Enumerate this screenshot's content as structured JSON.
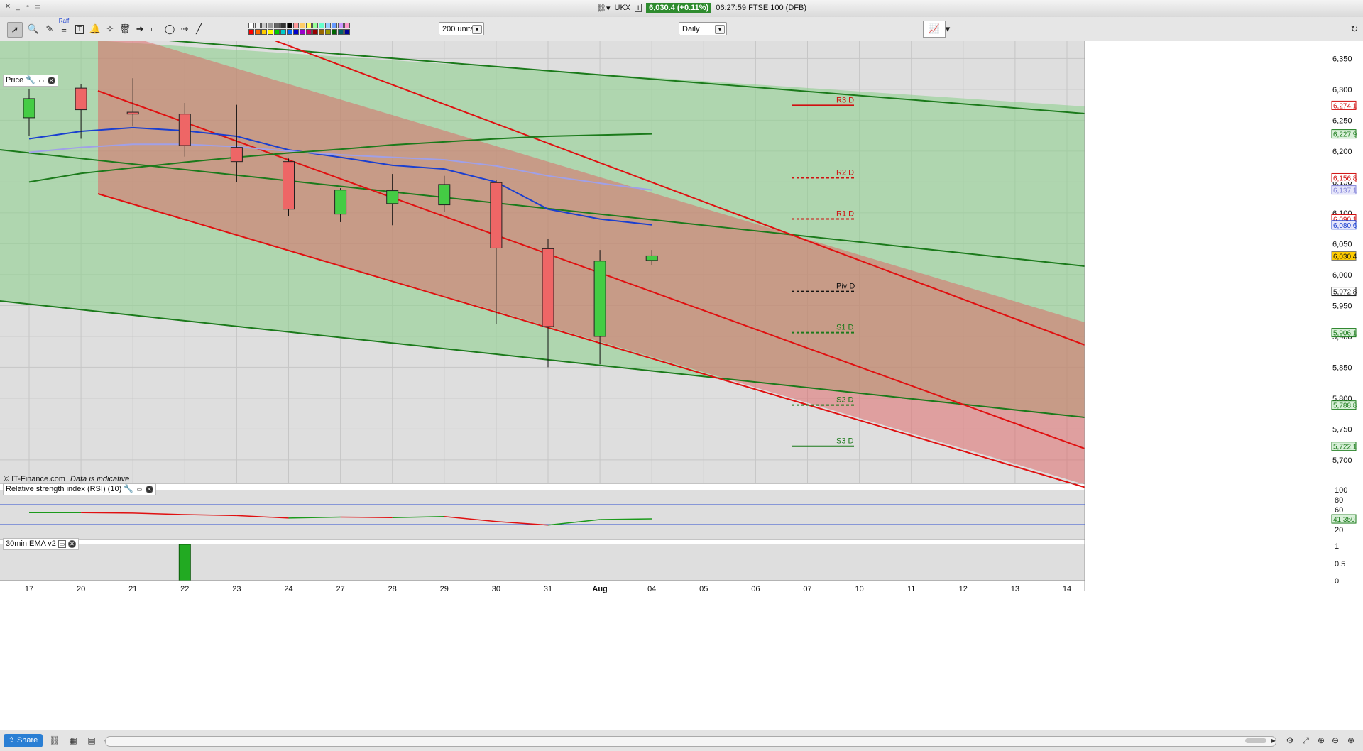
{
  "window": {
    "symbol": "UKX",
    "price_badge": "6,030.4 (+0.11%)",
    "time_title": "06:27:59 FTSE 100 (DFB)"
  },
  "toolbar": {
    "units_select": "200 units",
    "interval_select": "Daily",
    "raff_label": "Raff",
    "colors": [
      "#ffffff",
      "#eeeeee",
      "#cccccc",
      "#999999",
      "#666666",
      "#333333",
      "#000000",
      "#ff9999",
      "#ffcc66",
      "#ffff66",
      "#99ff99",
      "#66ffcc",
      "#99ccff",
      "#6699ff",
      "#cc99ff",
      "#ff99cc",
      "#ff0000",
      "#ff6600",
      "#ffcc00",
      "#ffff00",
      "#00cc00",
      "#00cccc",
      "#0066ff",
      "#0000cc",
      "#9900cc",
      "#cc0066",
      "#990000",
      "#996600",
      "#999900",
      "#006600",
      "#006666",
      "#000099"
    ]
  },
  "price_panel": {
    "title": "Price",
    "copyright": "© IT-Finance.com",
    "indicative": "Data is indicative",
    "y_ticks": [
      "6,350",
      "6,300",
      "6,250",
      "6,200",
      "6,150",
      "6,100",
      "6,050",
      "6,000",
      "5,950",
      "5,900",
      "5,850",
      "5,800",
      "5,750",
      "5,700"
    ],
    "tags": [
      {
        "label": "6,274.1",
        "value": 6274.1,
        "bg": "#ffffff",
        "color": "#d01010",
        "border": "#d01010"
      },
      {
        "label": "6,227.9",
        "value": 6227.9,
        "bg": "#d9f0d9",
        "color": "#1b7a1b",
        "border": "#1b7a1b"
      },
      {
        "label": "6,156.8",
        "value": 6156.8,
        "bg": "#ffffff",
        "color": "#d01010",
        "border": "#d01010"
      },
      {
        "label": "6,137.1",
        "value": 6137.1,
        "bg": "#e6e6fa",
        "color": "#8080d8",
        "border": "#8080d8"
      },
      {
        "label": "6,090.1",
        "value": 6090.1,
        "bg": "#ffffff",
        "color": "#d01010",
        "border": "#d01010"
      },
      {
        "label": "6,080.6",
        "value": 6080.6,
        "bg": "#e6e6fa",
        "color": "#1a3fd0",
        "border": "#1a3fd0"
      },
      {
        "label": "6,030.4",
        "value": 6030.4,
        "bg": "#ffcc00",
        "color": "#111111",
        "border": "#777777"
      },
      {
        "label": "5,972.8",
        "value": 5972.8,
        "bg": "#ffffff",
        "color": "#111111",
        "border": "#111111"
      },
      {
        "label": "5,906.1",
        "value": 5906.1,
        "bg": "#d9f0d9",
        "color": "#1b7a1b",
        "border": "#1b7a1b"
      },
      {
        "label": "5,788.8",
        "value": 5788.8,
        "bg": "#d9f0d9",
        "color": "#1b7a1b",
        "border": "#1b7a1b"
      },
      {
        "label": "5,722.1",
        "value": 5722.1,
        "bg": "#d9f0d9",
        "color": "#1b7a1b",
        "border": "#1b7a1b"
      }
    ]
  },
  "pivots": [
    {
      "label": "R3 D",
      "value": 6274.1,
      "color": "#d01010",
      "dash": false
    },
    {
      "label": "R2 D",
      "value": 6156.8,
      "color": "#d01010",
      "dash": true
    },
    {
      "label": "R1 D",
      "value": 6090.1,
      "color": "#d01010",
      "dash": true
    },
    {
      "label": "Piv D",
      "value": 5972.8,
      "color": "#111111",
      "dash": true
    },
    {
      "label": "S1 D",
      "value": 5906.1,
      "color": "#1b7a1b",
      "dash": true
    },
    {
      "label": "S2 D",
      "value": 5788.8,
      "color": "#1b7a1b",
      "dash": true
    },
    {
      "label": "S3 D",
      "value": 5722.1,
      "color": "#1b7a1b",
      "dash": false
    }
  ],
  "chart_data": {
    "type": "candlestick",
    "x_labels": [
      "17",
      "20",
      "21",
      "22",
      "23",
      "24",
      "27",
      "28",
      "29",
      "30",
      "31",
      "Aug",
      "04",
      "05",
      "06",
      "07",
      "10",
      "11",
      "12",
      "13",
      "14"
    ],
    "ylim": [
      5662,
      6378
    ],
    "candles": [
      {
        "x": "17",
        "open": 6254,
        "close": 6285,
        "high": 6300,
        "low": 6225
      },
      {
        "x": "20",
        "open": 6302,
        "close": 6267,
        "high": 6308,
        "low": 6220
      },
      {
        "x": "21",
        "open": 6263,
        "close": 6260,
        "high": 6318,
        "low": 6240
      },
      {
        "x": "22",
        "open": 6260,
        "close": 6209,
        "high": 6278,
        "low": 6191
      },
      {
        "x": "23",
        "open": 6206,
        "close": 6183,
        "high": 6275,
        "low": 6150
      },
      {
        "x": "24",
        "open": 6183,
        "close": 6106,
        "high": 6188,
        "low": 6095
      },
      {
        "x": "27",
        "open": 6098,
        "close": 6137,
        "high": 6140,
        "low": 6085
      },
      {
        "x": "28",
        "open": 6115,
        "close": 6136,
        "high": 6163,
        "low": 6080
      },
      {
        "x": "29",
        "open": 6113,
        "close": 6146,
        "high": 6160,
        "low": 6102
      },
      {
        "x": "30",
        "open": 6149,
        "close": 6043,
        "high": 6153,
        "low": 5920
      },
      {
        "x": "31",
        "open": 6042,
        "close": 5916,
        "high": 6058,
        "low": 5850
      },
      {
        "x": "Aug",
        "open": 5900,
        "close": 6022,
        "high": 6040,
        "low": 5855
      },
      {
        "x": "04",
        "open": 6023,
        "close": 6030.4,
        "high": 6040,
        "low": 6015
      }
    ],
    "series": [
      {
        "name": "EMA",
        "color": "#1a3fd0",
        "values": [
          6220,
          6232,
          6238,
          6233,
          6224,
          6202,
          6190,
          6177,
          6171,
          6150,
          6106,
          6090,
          6080.6
        ]
      },
      {
        "name": "EMA",
        "color": "#a0a0e8",
        "values": [
          6198,
          6206,
          6211,
          6211,
          6207,
          6200,
          6194,
          6190,
          6186,
          6176,
          6160,
          6148,
          6137.1
        ]
      },
      {
        "name": "EMA",
        "color": "#1b7a1b",
        "values": [
          6150,
          6164,
          6173,
          6182,
          6190,
          6197,
          6203,
          6210,
          6215,
          6220,
          6224,
          6226,
          6227.9
        ]
      }
    ],
    "rsi": {
      "title": "Relative strength index (RSI) (10)",
      "value_label": "41.350",
      "y_ticks": [
        "100",
        "80",
        "60",
        "40",
        "20"
      ],
      "values": [
        54,
        54,
        53,
        50,
        48,
        43,
        45,
        44,
        46,
        36,
        29,
        40,
        41.35
      ]
    },
    "ema_panel": {
      "title": "30min EMA v2",
      "y_ticks": [
        "1",
        "0.5",
        "0"
      ],
      "bar_x": "22",
      "bar_value": 1
    }
  }
}
